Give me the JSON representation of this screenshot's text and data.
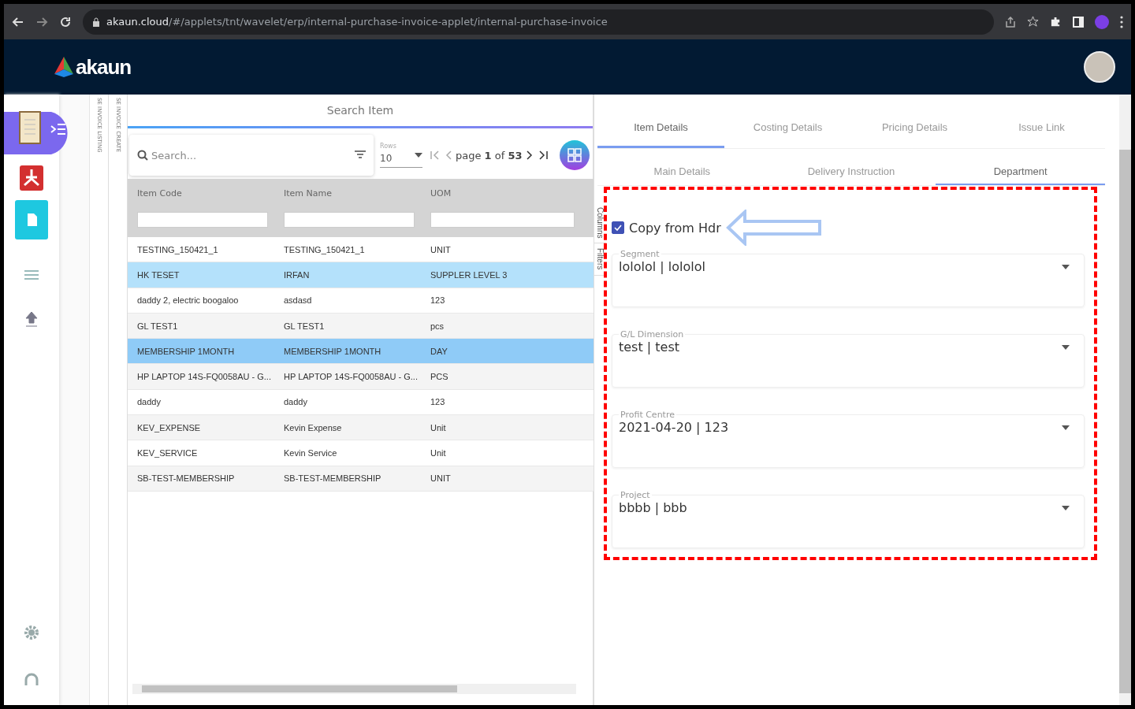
{
  "browser": {
    "url_host": "akaun.cloud",
    "url_path": "/#/applets/tnt/wavelet/erp/internal-purchase-invoice-applet/internal-purchase-invoice"
  },
  "header": {
    "logo": "akaun"
  },
  "vertical_tabs": [
    "SE INVOICE LISTING",
    "SE INVOICE CREATE"
  ],
  "search_panel": {
    "title": "Search Item",
    "search": {
      "placeholder": "Search..."
    },
    "rows_label": "Rows",
    "rows_value": "10",
    "pagination": {
      "page_word": "page",
      "page": "1",
      "of_word": "of",
      "total": "53"
    },
    "columns": [
      "Item Code",
      "Item Name",
      "UOM"
    ],
    "rows": [
      {
        "cells": [
          "TESTING_150421_1",
          "TESTING_150421_1",
          "UNIT"
        ],
        "selected": false,
        "hovered": false
      },
      {
        "cells": [
          "HK TESET",
          "IRFAN",
          "SUPPLER LEVEL 3"
        ],
        "selected": false,
        "hovered": true
      },
      {
        "cells": [
          "daddy 2, electric boogaloo",
          "asdasd",
          "123"
        ],
        "selected": false,
        "hovered": false
      },
      {
        "cells": [
          "GL TEST1",
          "GL TEST1",
          "pcs"
        ],
        "selected": false,
        "hovered": false
      },
      {
        "cells": [
          "MEMBERSHIP 1MONTH",
          "MEMBERSHIP 1MONTH",
          "DAY"
        ],
        "selected": true,
        "hovered": false
      },
      {
        "cells": [
          "HP LAPTOP 14S-FQ0058AU - G...",
          "HP LAPTOP 14S-FQ0058AU - G...",
          "PCS"
        ],
        "selected": false,
        "hovered": false
      },
      {
        "cells": [
          "daddy",
          "daddy",
          "123"
        ],
        "selected": false,
        "hovered": false
      },
      {
        "cells": [
          "KEV_EXPENSE",
          "Kevin Expense",
          "Unit"
        ],
        "selected": false,
        "hovered": false
      },
      {
        "cells": [
          "KEV_SERVICE",
          "Kevin Service",
          "Unit"
        ],
        "selected": false,
        "hovered": false
      },
      {
        "cells": [
          "SB-TEST-MEMBERSHIP",
          "SB-TEST-MEMBERSHIP",
          "UNIT"
        ],
        "selected": false,
        "hovered": false
      }
    ],
    "side_tabs": [
      "Columns",
      "Filters"
    ]
  },
  "details": {
    "tabs": [
      {
        "label": "Item Details",
        "selected": true
      },
      {
        "label": "Costing Details",
        "selected": false
      },
      {
        "label": "Pricing Details",
        "selected": false
      },
      {
        "label": "Issue Link",
        "selected": false
      }
    ],
    "sub_tabs": [
      {
        "label": "Main Details",
        "selected": false
      },
      {
        "label": "Delivery Instruction",
        "selected": false
      },
      {
        "label": "Department",
        "selected": true
      }
    ],
    "copy_from_hdr": {
      "label": "Copy from Hdr",
      "checked": true
    },
    "fields": [
      {
        "label": "Segment",
        "value": "lololol | lololol"
      },
      {
        "label": "G/L Dimension",
        "value": "test | test"
      },
      {
        "label": "Profit Centre",
        "value": "2021-04-20 | 123"
      },
      {
        "label": "Project",
        "value": "bbbb | bbb"
      }
    ]
  }
}
